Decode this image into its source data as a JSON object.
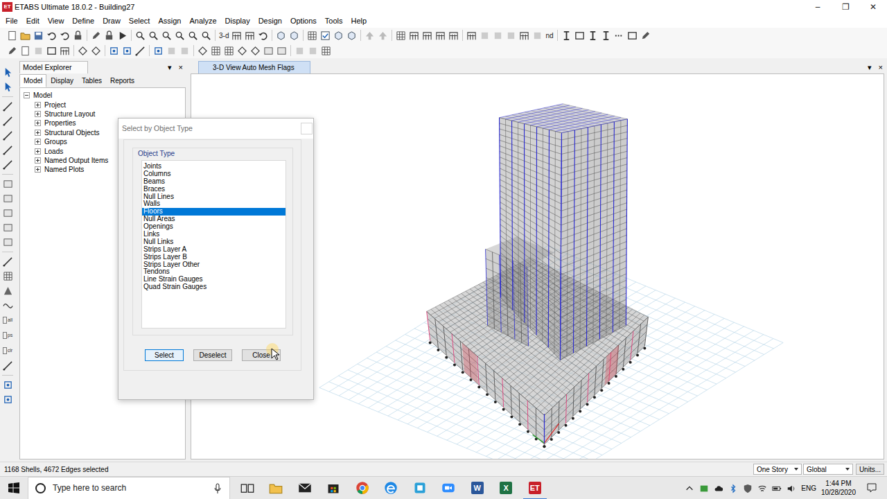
{
  "window": {
    "title": "ETABS Ultimate 18.0.2 - Building27",
    "app_icon": "ET",
    "controls": [
      "–",
      "❐",
      "✕"
    ]
  },
  "menu": [
    "File",
    "Edit",
    "View",
    "Define",
    "Draw",
    "Select",
    "Assign",
    "Analyze",
    "Display",
    "Design",
    "Options",
    "Tools",
    "Help"
  ],
  "toolbar": {
    "view_3d": "3-d",
    "nd": "nd"
  },
  "left_toolbar": [
    "all",
    "ps",
    "clr"
  ],
  "explorer": {
    "title": "Model Explorer",
    "header_buttons": [
      "▾",
      "×"
    ],
    "tabs": [
      {
        "label": "Model",
        "selected": true
      },
      {
        "label": "Display",
        "selected": false
      },
      {
        "label": "Tables",
        "selected": false
      },
      {
        "label": "Reports",
        "selected": false
      }
    ],
    "tree": [
      {
        "label": "Model",
        "expanded": true,
        "kind": "root"
      },
      {
        "label": "Project",
        "expanded": false,
        "kind": "node"
      },
      {
        "label": "Structure Layout",
        "expanded": false,
        "kind": "node"
      },
      {
        "label": "Properties",
        "expanded": false,
        "kind": "node"
      },
      {
        "label": "Structural Objects",
        "expanded": false,
        "kind": "node"
      },
      {
        "label": "Groups",
        "expanded": false,
        "kind": "node"
      },
      {
        "label": "Loads",
        "expanded": false,
        "kind": "node"
      },
      {
        "label": "Named Output Items",
        "expanded": false,
        "kind": "node"
      },
      {
        "label": "Named Plots",
        "expanded": false,
        "kind": "node"
      }
    ]
  },
  "view": {
    "tab": {
      "label": "3-D View  Auto Mesh Flags",
      "selected": true
    },
    "buttons": [
      "▾",
      "×"
    ]
  },
  "dialog": {
    "title": "Select by Object Type",
    "group": "Object Type",
    "items": [
      {
        "label": "Joints",
        "selected": false
      },
      {
        "label": "Columns",
        "selected": false
      },
      {
        "label": "Beams",
        "selected": false
      },
      {
        "label": "Braces",
        "selected": false
      },
      {
        "label": "Null Lines",
        "selected": false
      },
      {
        "label": "Walls",
        "selected": false
      },
      {
        "label": "Floors",
        "selected": true
      },
      {
        "label": "Null Areas",
        "selected": false
      },
      {
        "label": "Openings",
        "selected": false
      },
      {
        "label": "Links",
        "selected": false
      },
      {
        "label": "Null Links",
        "selected": false
      },
      {
        "label": "Strips Layer A",
        "selected": false
      },
      {
        "label": "Strips Layer B",
        "selected": false
      },
      {
        "label": "Strips Layer Other",
        "selected": false
      },
      {
        "label": "Tendons",
        "selected": false
      },
      {
        "label": "Line Strain Gauges",
        "selected": false
      },
      {
        "label": "Quad Strain Gauges",
        "selected": false
      }
    ],
    "buttons": [
      {
        "label": "Select",
        "default": true
      },
      {
        "label": "Deselect",
        "default": false
      },
      {
        "label": "Close",
        "default": false
      }
    ]
  },
  "status_bar": {
    "text": "1168 Shells, 4672 Edges selected",
    "story": "One Story",
    "coord_system": "Global",
    "units": "Units..."
  },
  "taskbar": {
    "search": "Type here to search",
    "apps": [
      {
        "label": "W",
        "color": "#2b579a",
        "selected": false
      },
      {
        "label": "X",
        "color": "#1f7244",
        "selected": false
      },
      {
        "label": "ET",
        "color": "#c8202a",
        "selected": true
      }
    ],
    "lang": "ENG",
    "time": "1:44 PM",
    "date": "10/28/2020"
  }
}
